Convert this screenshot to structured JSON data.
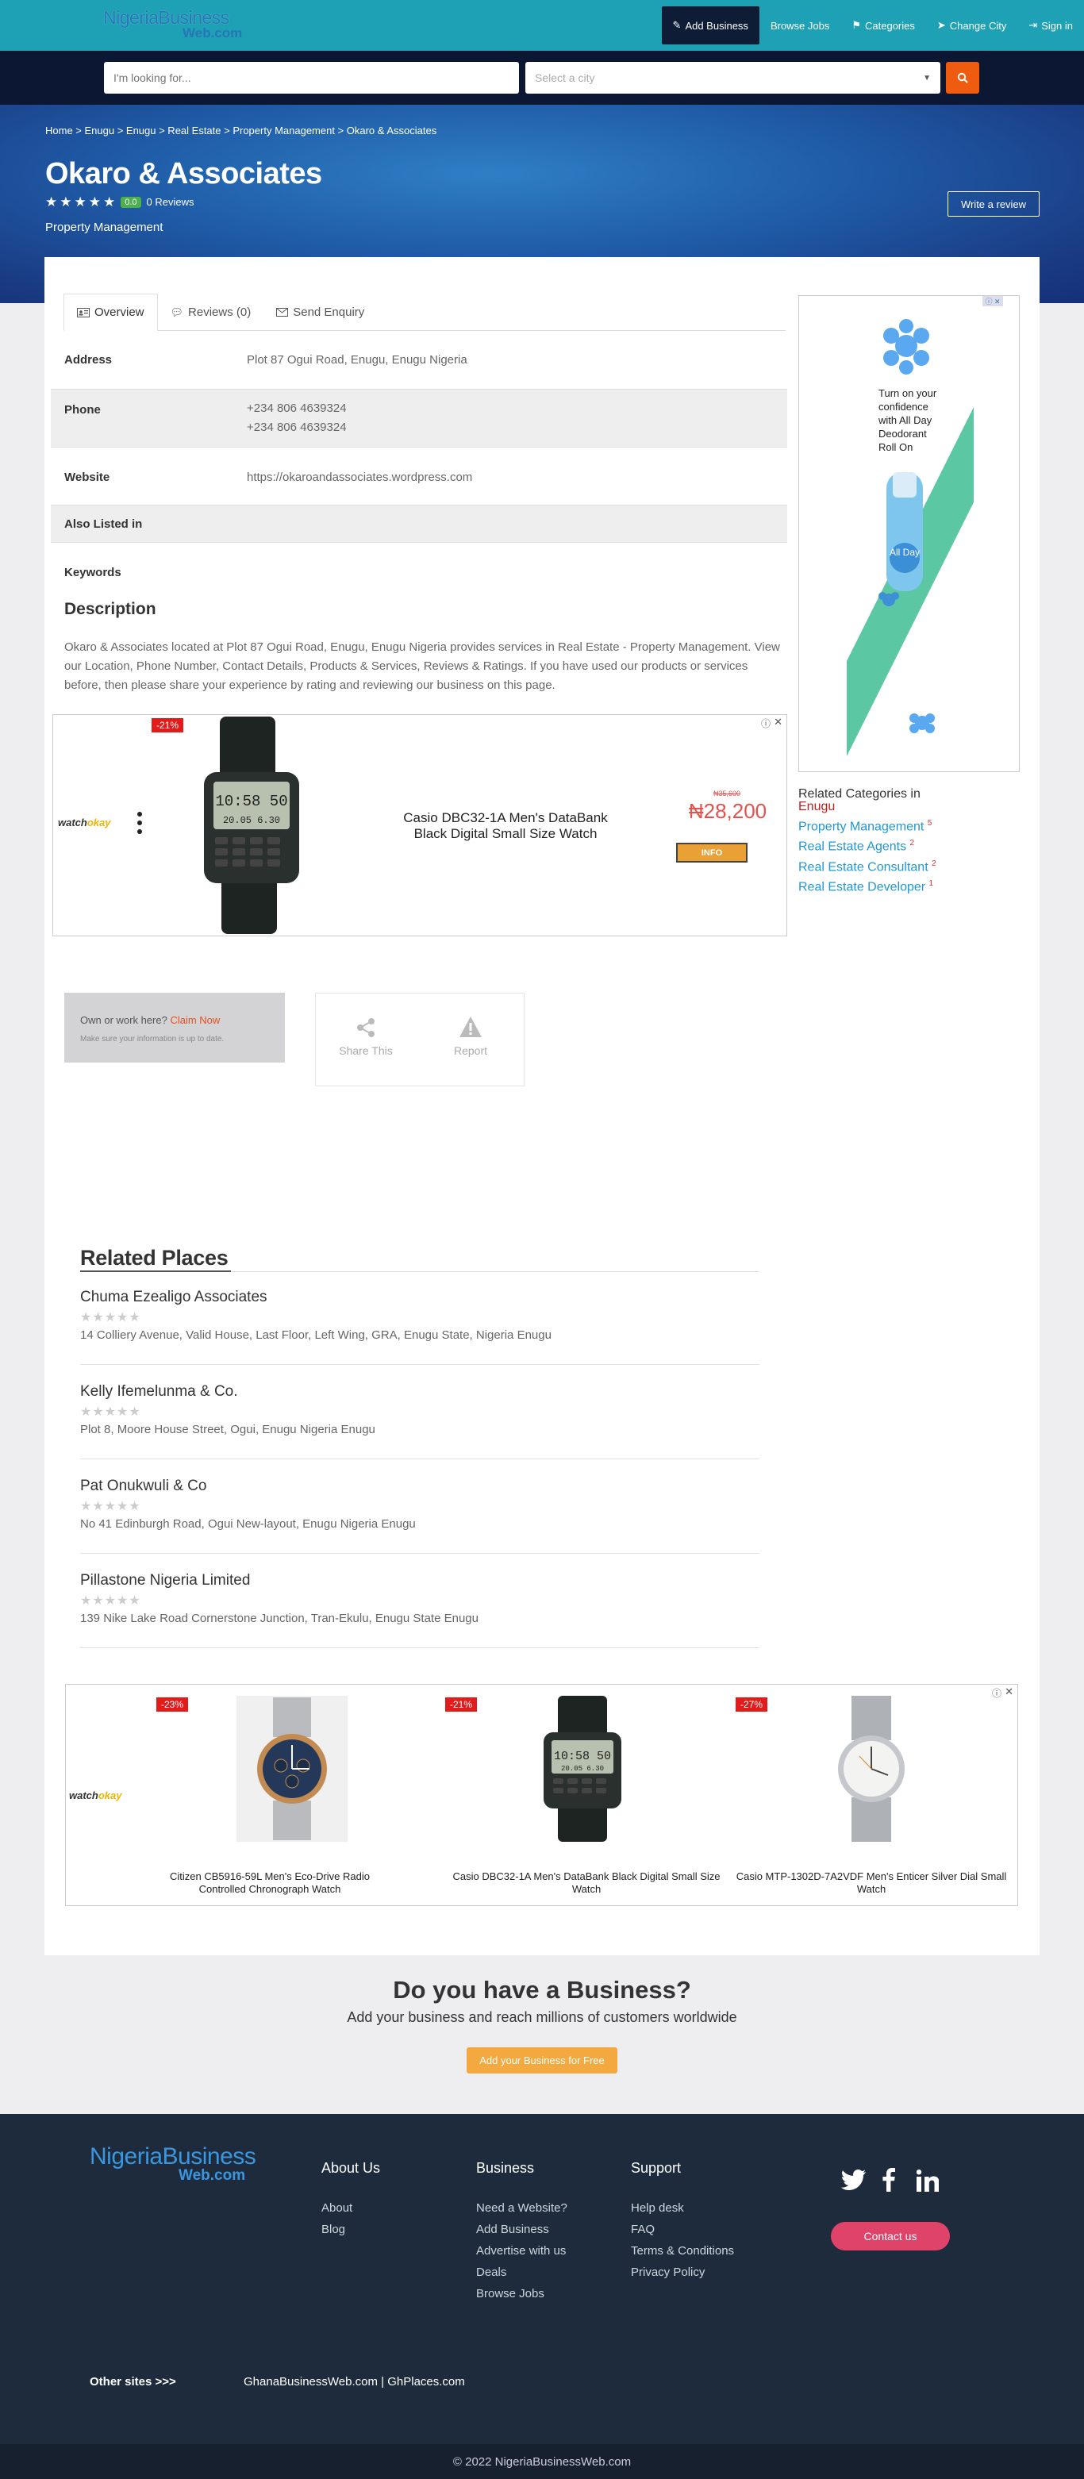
{
  "brand": {
    "logo_main": "NigeriaBusiness",
    "logo_sub": "Web.com",
    "footer_logo_main": "NigeriaBusiness",
    "footer_logo_sub": "Web.com"
  },
  "nav": {
    "items": [
      {
        "label": "Add Business",
        "icon": "pencil-icon"
      },
      {
        "label": "Browse Jobs",
        "icon": ""
      },
      {
        "label": "Categories",
        "icon": "flag-icon"
      },
      {
        "label": "Change City",
        "icon": "location-arrow-icon"
      },
      {
        "label": "Sign in",
        "icon": "sign-in-icon"
      }
    ]
  },
  "search": {
    "placeholder": "I'm looking for...",
    "city_placeholder": "Select a city"
  },
  "breadcrumb": "Home > Enugu > Enugu > Real Estate > Property Management > Okaro & Associates",
  "business": {
    "name": "Okaro & Associates",
    "score": "0.0",
    "reviews": "0 Reviews",
    "category": "Property Management",
    "write_review": "Write a review"
  },
  "tabs": [
    {
      "label": "Overview",
      "icon": "id-card-icon"
    },
    {
      "label": "Reviews (0)",
      "icon": "comment-icon"
    },
    {
      "label": "Send Enquiry",
      "icon": "envelope-icon"
    }
  ],
  "details": {
    "address_label": "Address",
    "address": "Plot 87 Ogui Road, Enugu, Enugu Nigeria",
    "phone_label": "Phone",
    "phone1": "+234 806 4639324",
    "phone2": "+234 806 4639324",
    "website_label": "Website",
    "website": "https://okaroandassociates.wordpress.com",
    "also_listed_label": "Also Listed in",
    "keywords_label": "Keywords"
  },
  "description": {
    "title": "Description",
    "text": "Okaro & Associates located at Plot 87 Ogui Road, Enugu, Enugu Nigeria provides services in Real Estate - Property Management. View our Location, Phone Number, Contact Details, Products & Services, Reviews & Ratings. If you have used our products or services before, then please share your experience by rating and reviewing our business on this page."
  },
  "ad1": {
    "brand": "watch",
    "brand_accent": "okay",
    "discount": "-21%",
    "product": "Casio DBC32-1A Men's DataBank Black Digital Small Size Watch",
    "old_price": "₦35,600",
    "price": "₦28,200",
    "button": "INFO"
  },
  "side_ad": {
    "text": "Turn on your confidence with All Day Deodorant Roll On",
    "product_label": "All Day"
  },
  "related_categories": {
    "title": "Related Categories in",
    "city": "Enugu",
    "items": [
      {
        "label": "Property Management",
        "count": "5"
      },
      {
        "label": "Real Estate Agents",
        "count": "2"
      },
      {
        "label": "Real Estate Consultant",
        "count": "2"
      },
      {
        "label": "Real Estate Developer",
        "count": "1"
      }
    ]
  },
  "claim": {
    "question": "Own or work here?",
    "link": "Claim Now",
    "note": "Make sure your information is up to date."
  },
  "actions": {
    "share": "Share This",
    "report": "Report"
  },
  "related_places": {
    "title": "Related Places",
    "items": [
      {
        "name": "Chuma Ezealigo Associates",
        "address": "14 Colliery Avenue, Valid House, Last Floor, Left Wing, GRA, Enugu State, Nigeria Enugu"
      },
      {
        "name": "Kelly Ifemelunma & Co.",
        "address": "Plot 8, Moore House Street, Ogui, Enugu Nigeria Enugu"
      },
      {
        "name": "Pat Onukwuli & Co",
        "address": "No 41 Edinburgh Road, Ogui New-layout, Enugu Nigeria Enugu"
      },
      {
        "name": "Pillastone Nigeria Limited",
        "address": "139 Nike Lake Road Cornerstone Junction, Tran-Ekulu, Enugu State Enugu"
      }
    ]
  },
  "ad2": {
    "brand": "watch",
    "brand_accent": "okay",
    "products": [
      {
        "discount": "-23%",
        "name": "Citizen CB5916-59L Men's Eco-Drive Radio Controlled Chronograph Watch"
      },
      {
        "discount": "-21%",
        "name": "Casio DBC32-1A Men's DataBank Black Digital Small Size Watch"
      },
      {
        "discount": "-27%",
        "name": "Casio MTP-1302D-7A2VDF Men's Enticer Silver Dial Small Watch"
      }
    ]
  },
  "cta": {
    "title": "Do you have a Business?",
    "subtitle": "Add your business and reach millions of customers worldwide",
    "button": "Add your Business for Free"
  },
  "footer": {
    "about_title": "About Us",
    "about_links": [
      "About",
      "Blog"
    ],
    "business_title": "Business",
    "business_links": [
      "Need a Website?",
      "Add Business",
      "Advertise with us",
      "Deals",
      "Browse Jobs"
    ],
    "support_title": "Support",
    "support_links": [
      "Help desk",
      "FAQ",
      "Terms & Conditions",
      "Privacy Policy"
    ],
    "contact_button": "Contact us",
    "other_sites_label": "Other sites >>>",
    "other_site_1": "GhanaBusinessWeb.com",
    "other_sites_separator": "|",
    "other_site_2": "GhPlaces.com",
    "copyright": "© 2022 NigeriaBusinessWeb.com"
  },
  "colors": {
    "topbar": "#1ea1b4",
    "search_bg": "#0b1733",
    "accent_orange": "#f05c0f",
    "link_blue": "#2098d1",
    "footer": "#1d2b3c",
    "cta_button": "#f3a93f",
    "contact_button": "#e0436a"
  }
}
